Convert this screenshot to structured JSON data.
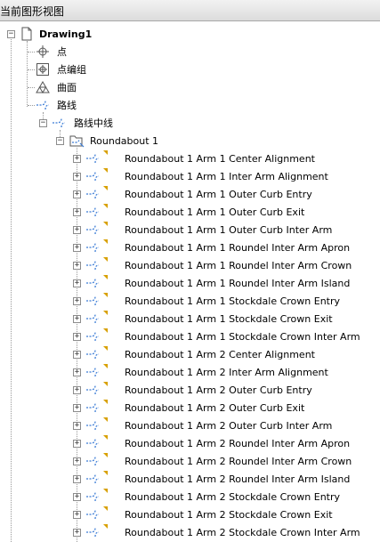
{
  "window": {
    "title": "当前图形视图"
  },
  "tree": {
    "root": {
      "label": "Drawing1"
    },
    "top_items": [
      {
        "label": "点",
        "icon": "point-icon"
      },
      {
        "label": "点编组",
        "icon": "point-group-icon"
      },
      {
        "label": "曲面",
        "icon": "surface-icon"
      },
      {
        "label": "路线",
        "icon": "alignment-icon"
      }
    ],
    "centerline": {
      "label": "路线中线"
    },
    "roundabout": {
      "label": "Roundabout 1"
    },
    "alignments": [
      "Roundabout 1 Arm 1 Center Alignment",
      "Roundabout 1 Arm 1 Inter Arm Alignment",
      "Roundabout 1 Arm 1 Outer Curb Entry",
      "Roundabout 1 Arm 1 Outer Curb Exit",
      "Roundabout 1 Arm 1 Outer Curb Inter Arm",
      "Roundabout 1 Arm 1 Roundel Inter Arm Apron",
      "Roundabout 1 Arm 1 Roundel Inter Arm Crown",
      "Roundabout 1 Arm 1 Roundel Inter Arm Island",
      "Roundabout 1 Arm 1 Stockdale Crown Entry",
      "Roundabout 1 Arm 1 Stockdale Crown Exit",
      "Roundabout 1 Arm 1 Stockdale Crown Inter Arm",
      "Roundabout 1 Arm 2 Center Alignment",
      "Roundabout 1 Arm 2 Inter Arm Alignment",
      "Roundabout 1 Arm 2 Outer Curb Entry",
      "Roundabout 1 Arm 2 Outer Curb Exit",
      "Roundabout 1 Arm 2 Outer Curb Inter Arm",
      "Roundabout 1 Arm 2 Roundel Inter Arm Apron",
      "Roundabout 1 Arm 2 Roundel Inter Arm Crown",
      "Roundabout 1 Arm 2 Roundel Inter Arm Island",
      "Roundabout 1 Arm 2 Stockdale Crown Entry",
      "Roundabout 1 Arm 2 Stockdale Crown Exit",
      "Roundabout 1 Arm 2 Stockdale Crown Inter Arm"
    ],
    "expander_collapsed": "+",
    "expander_expanded": "−"
  },
  "colors": {
    "flag": "#d8a000",
    "alignment_icon": "#3a7bd5",
    "tree_lines": "#9a9a9a"
  }
}
